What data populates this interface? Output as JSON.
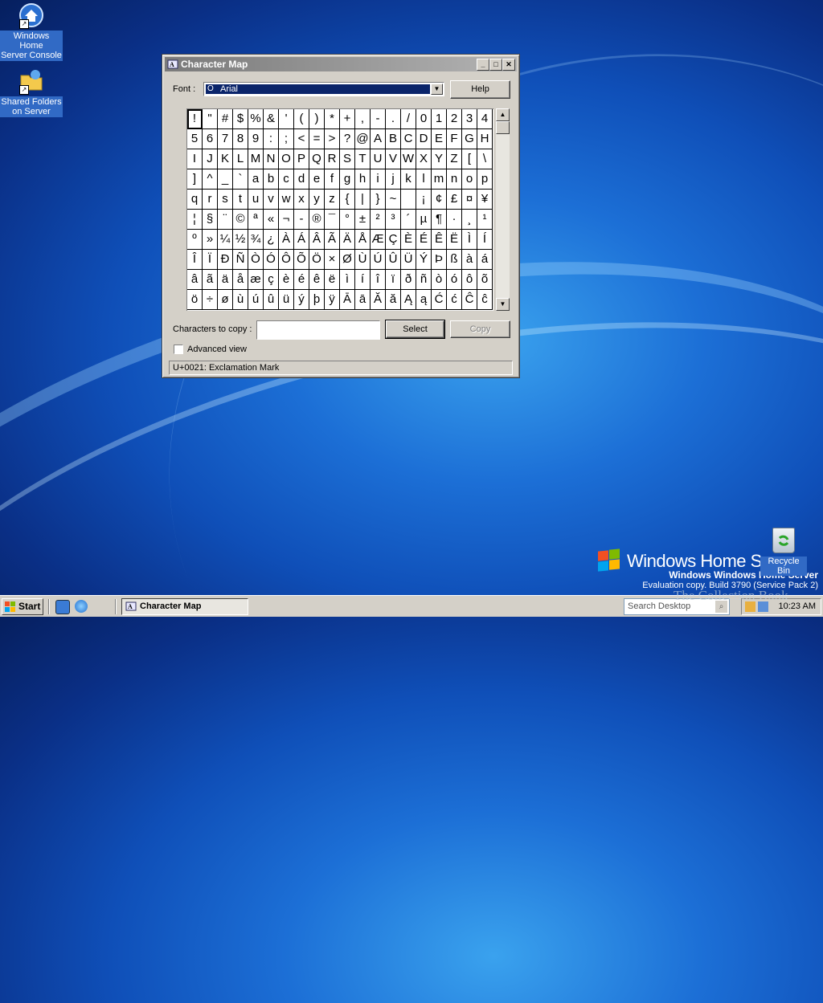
{
  "desktop": {
    "icons": [
      {
        "label_line1": "Windows Home",
        "label_line2": "Server Console"
      },
      {
        "label_line1": "Shared Folders",
        "label_line2": "on Server"
      }
    ],
    "recycle_bin": "Recycle Bin",
    "branding": {
      "product": "Windows Home Server",
      "eval_line1": "Windows Windows Home Server",
      "eval_line2": "Evaluation copy. Build 3790 (Service Pack 2)",
      "watermark": "The Collection Book"
    }
  },
  "window": {
    "title": "Character Map",
    "font_label": "Font :",
    "font_value": "Arial",
    "help_button": "Help",
    "characters": [
      "!",
      "\"",
      "#",
      "$",
      "%",
      "&",
      "'",
      "(",
      ")",
      "*",
      "+",
      ",",
      "-",
      ".",
      "/",
      "0",
      "1",
      "2",
      "3",
      "4",
      "5",
      "6",
      "7",
      "8",
      "9",
      ":",
      ";",
      "<",
      "=",
      ">",
      "?",
      "@",
      "A",
      "B",
      "C",
      "D",
      "E",
      "F",
      "G",
      "H",
      "I",
      "J",
      "K",
      "L",
      "M",
      "N",
      "O",
      "P",
      "Q",
      "R",
      "S",
      "T",
      "U",
      "V",
      "W",
      "X",
      "Y",
      "Z",
      "[",
      "\\",
      "]",
      "^",
      "_",
      "`",
      "a",
      "b",
      "c",
      "d",
      "e",
      "f",
      "g",
      "h",
      "i",
      "j",
      "k",
      "l",
      "m",
      "n",
      "o",
      "p",
      "q",
      "r",
      "s",
      "t",
      "u",
      "v",
      "w",
      "x",
      "y",
      "z",
      "{",
      "|",
      "}",
      "~",
      " ",
      "¡",
      "¢",
      "£",
      "¤",
      "¥",
      "¦",
      "§",
      "¨",
      "©",
      "ª",
      "«",
      "¬",
      "-",
      "®",
      "¯",
      "°",
      "±",
      "²",
      "³",
      "´",
      "µ",
      "¶",
      "·",
      "¸",
      "¹",
      "º",
      "»",
      "¼",
      "½",
      "¾",
      "¿",
      "À",
      "Á",
      "Â",
      "Ã",
      "Ä",
      "Å",
      "Æ",
      "Ç",
      "È",
      "É",
      "Ê",
      "Ë",
      "Ì",
      "Í",
      "Î",
      "Ï",
      "Ð",
      "Ñ",
      "Ò",
      "Ó",
      "Ô",
      "Õ",
      "Ö",
      "×",
      "Ø",
      "Ù",
      "Ú",
      "Û",
      "Ü",
      "Ý",
      "Þ",
      "ß",
      "à",
      "á",
      "â",
      "ã",
      "ä",
      "å",
      "æ",
      "ç",
      "è",
      "é",
      "ê",
      "ë",
      "ì",
      "í",
      "î",
      "ï",
      "ð",
      "ñ",
      "ò",
      "ó",
      "ô",
      "õ",
      "ö",
      "÷",
      "ø",
      "ù",
      "ú",
      "û",
      "ü",
      "ý",
      "þ",
      "ÿ",
      "Ā",
      "ā",
      "Ă",
      "ă",
      "Ą",
      "ą",
      "Ć",
      "ć",
      "Ĉ",
      "ĉ"
    ],
    "selected_index": 0,
    "copy_label": "Characters to copy :",
    "copy_value": "",
    "select_button": "Select",
    "copy_button": "Copy",
    "advanced_label": "Advanced view",
    "advanced_checked": false,
    "status": "U+0021: Exclamation Mark"
  },
  "taskbar": {
    "start": "Start",
    "task_label": "Character Map",
    "search_placeholder": "Search Desktop",
    "clock": "10:23 AM"
  }
}
